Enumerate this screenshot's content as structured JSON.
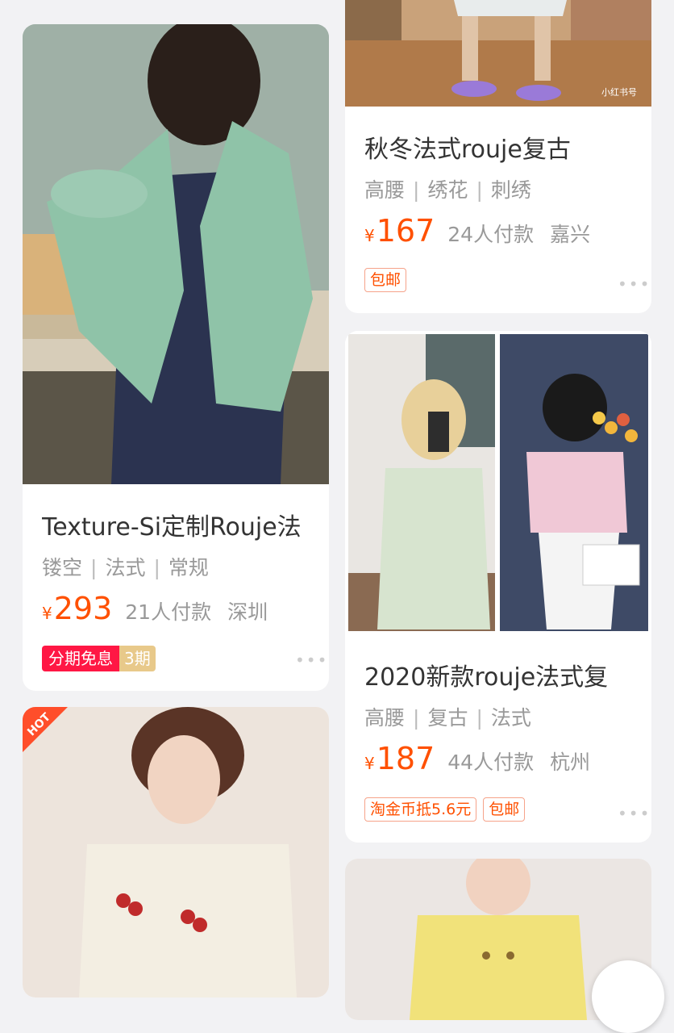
{
  "products": [
    {
      "title": "Texture-Si定制Rouje法",
      "tags": [
        "镂空",
        "法式",
        "常规"
      ],
      "currency": "¥",
      "price": "293",
      "sales": "21人付款",
      "location": "深圳",
      "installment_label": "分期免息",
      "installment_count": "3期"
    },
    {
      "title": "秋冬法式rouje复古",
      "tags": [
        "高腰",
        "绣花",
        "刺绣"
      ],
      "currency": "¥",
      "price": "167",
      "sales": "24人付款",
      "location": "嘉兴",
      "badges": [
        "包邮"
      ],
      "watermark": "小红书号"
    },
    {
      "title": "2020新款rouje法式复",
      "tags": [
        "高腰",
        "复古",
        "法式"
      ],
      "currency": "¥",
      "price": "187",
      "sales": "44人付款",
      "location": "杭州",
      "badges": [
        "淘金币抵5.6元",
        "包邮"
      ]
    },
    {
      "hot_label": "HOT"
    }
  ],
  "more_dots": "•••"
}
